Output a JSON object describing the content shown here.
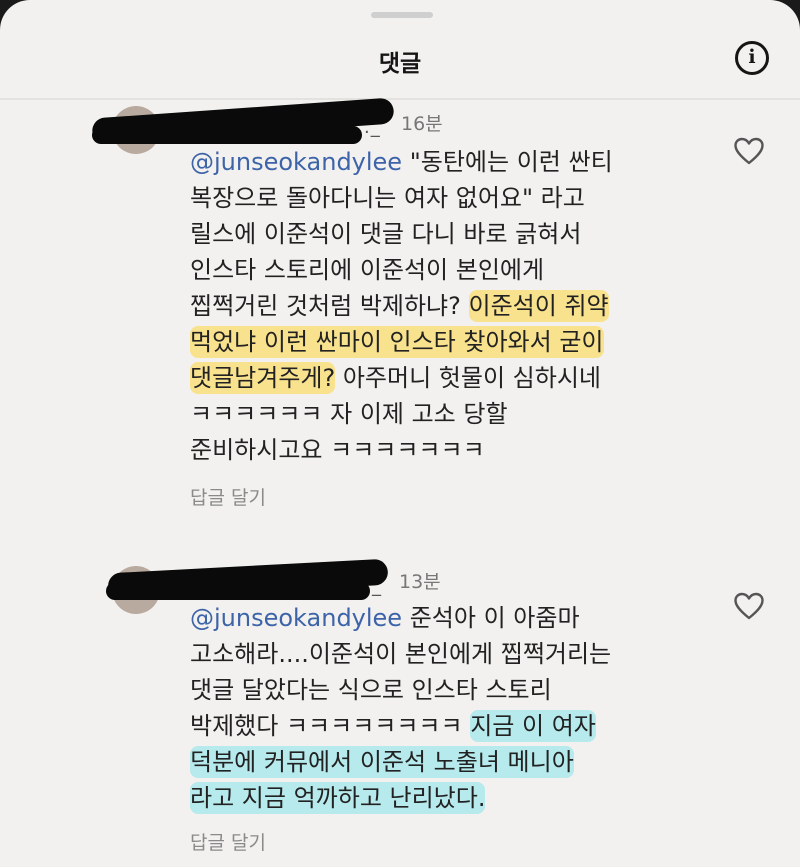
{
  "header": {
    "title": "댓글",
    "info_icon": "info-icon",
    "info_glyph": "i"
  },
  "comments": [
    {
      "username_tail": "._",
      "time": "16분",
      "mention": "@junseokandylee",
      "lines": [
        " \"동탄에는 이런 싼티",
        "복장으로 돌아다니는 여자 없어요\" 라고",
        "릴스에 이준석이 댓글 다니 바로 긁혀서",
        "인스타 스토리에 이준석이 본인에게",
        "찝쩍거린 것처럼 박제하냐? ",
        "이준석이 쥐약",
        "먹었냐 이런 싼마이 인스타 찾아와서 굳이",
        "댓글남겨주게?",
        " 아주머니 헛물이 심하시네",
        "ㅋㅋㅋㅋㅋㅋ 자 이제 고소 당할",
        "준비하시고요 ㅋㅋㅋㅋㅋㅋㅋ"
      ],
      "reply_label": "답글 달기"
    },
    {
      "username_tail": "_",
      "time": "13분",
      "mention": "@junseokandylee",
      "lines": [
        " 준석아 이 아줌마",
        "고소해라....이준석이 본인에게 찝쩍거리는",
        "댓글 달았다는 식으로 인스타 스토리",
        "박제했다 ㅋㅋㅋㅋㅋㅋㅋㅋ ",
        "지금 이 여자",
        "덕분에 커뮤에서 이준석 노출녀 메니아",
        "라고 지금 억까하고 난리났다."
      ],
      "reply_label": "답글 달기"
    }
  ]
}
